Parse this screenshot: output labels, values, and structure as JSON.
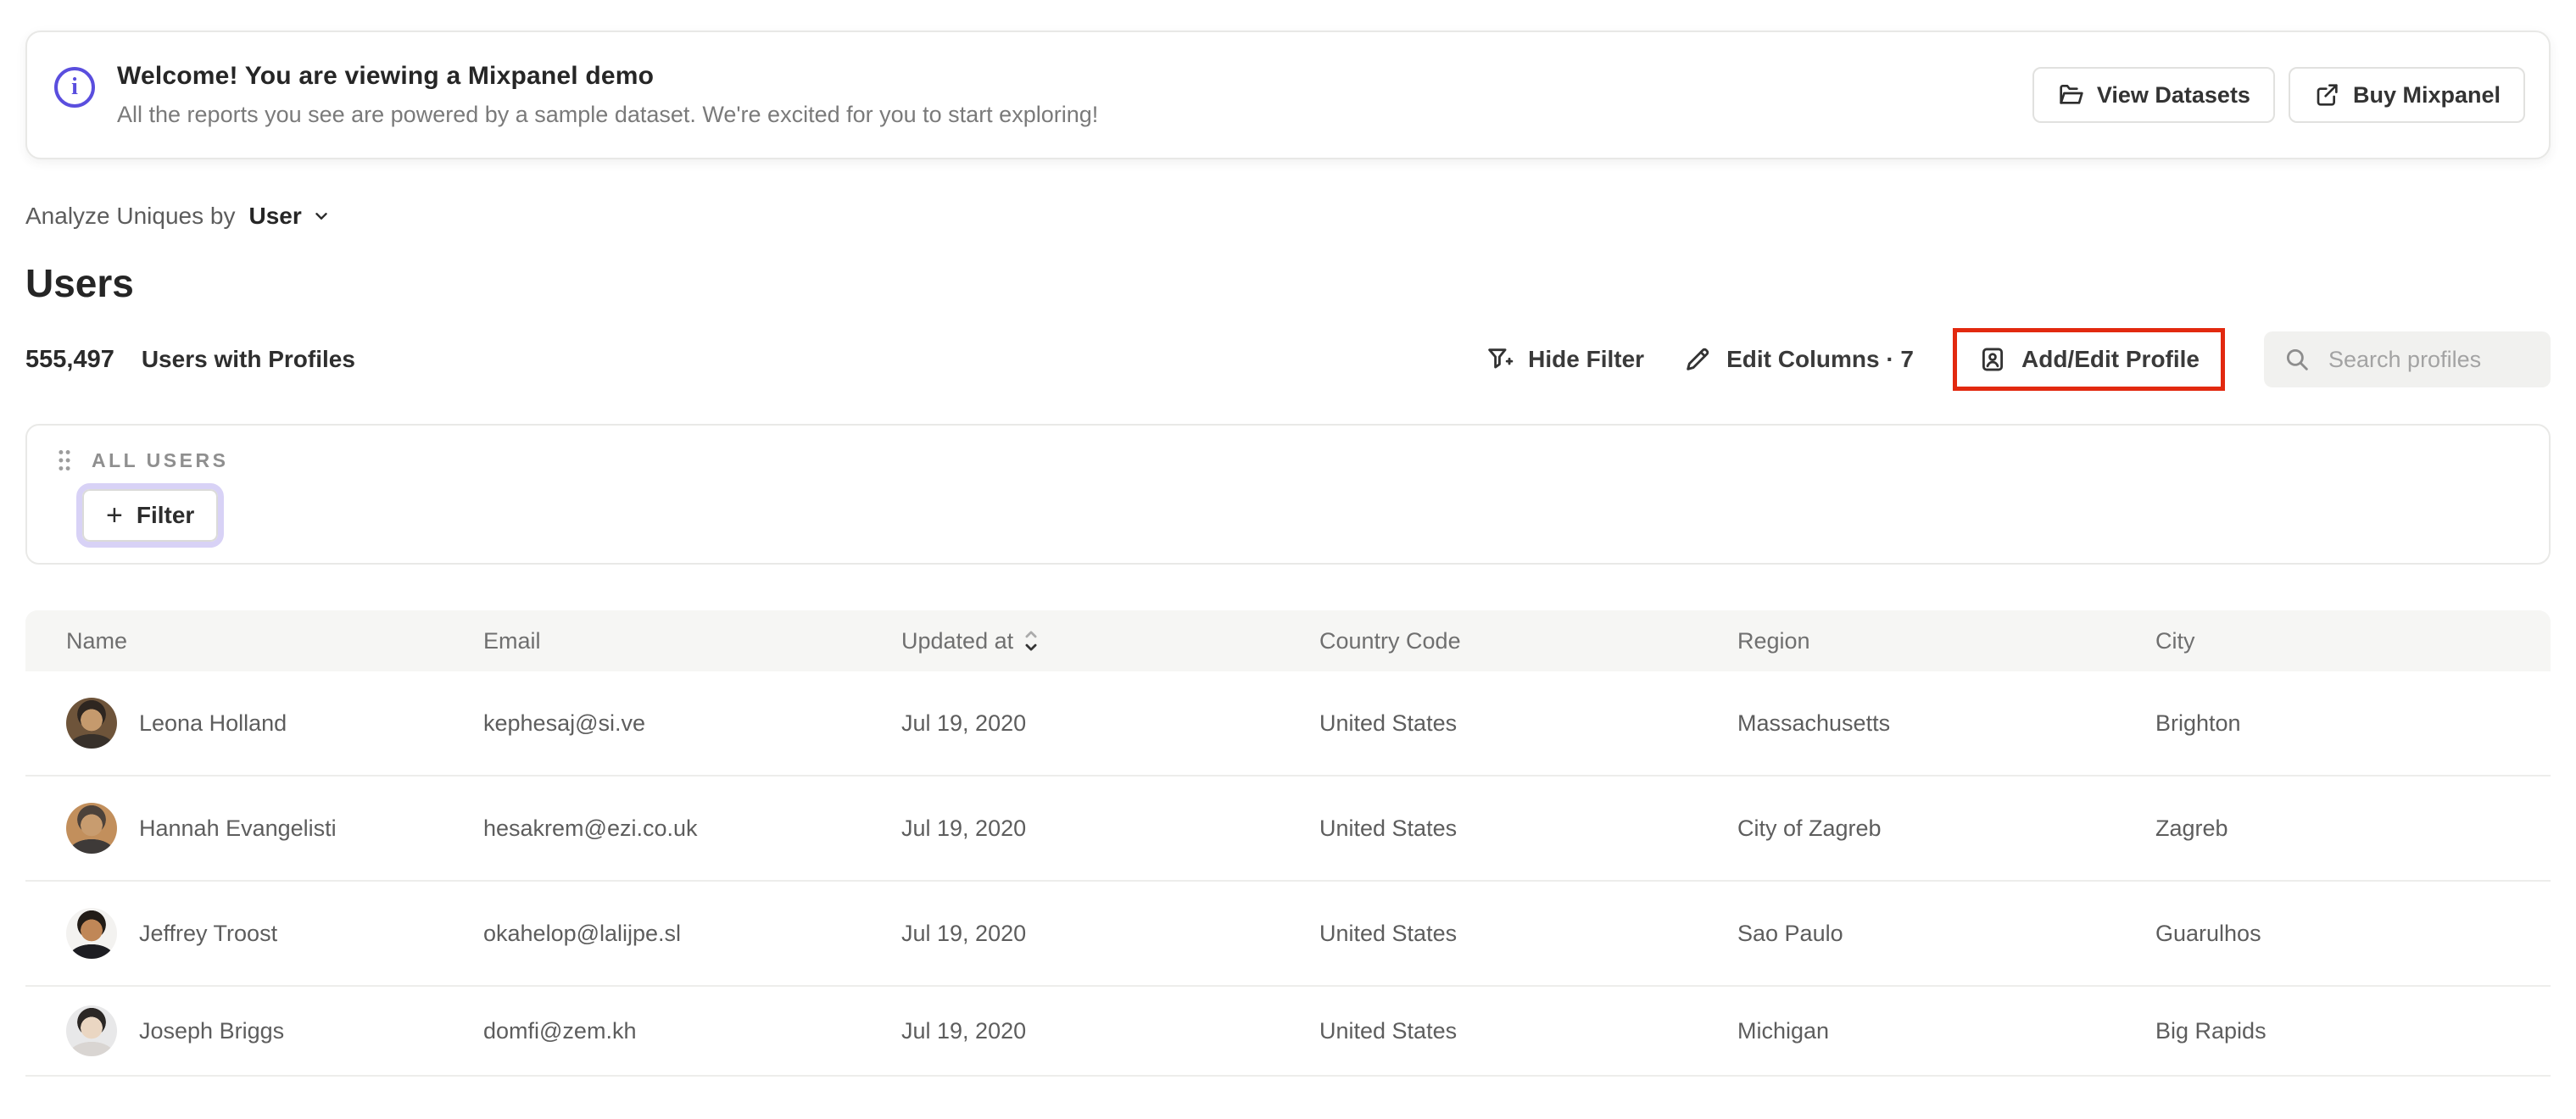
{
  "banner": {
    "title": "Welcome! You are viewing a Mixpanel demo",
    "subtitle": "All the reports you see are powered by a sample dataset. We're excited for you to start exploring!",
    "view_datasets_label": "View Datasets",
    "buy_mixpanel_label": "Buy Mixpanel",
    "info_icon": "info-icon",
    "accent_color": "#5a4ede"
  },
  "controls": {
    "analyze_label": "Analyze Uniques by",
    "analyze_value": "User"
  },
  "page": {
    "title": "Users",
    "count": "555,497",
    "count_label": "Users with Profiles"
  },
  "toolbar": {
    "hide_filter_label": "Hide Filter",
    "edit_columns_label": "Edit Columns · 7",
    "add_edit_profile_label": "Add/Edit Profile",
    "search_placeholder": "Search profiles",
    "highlight_color": "#e2290f"
  },
  "filter_panel": {
    "group_label": "ALL USERS",
    "plus": "+",
    "filter_label": "Filter",
    "focus_ring_color": "#d8d2f6"
  },
  "table": {
    "columns": [
      "Name",
      "Email",
      "Updated at",
      "Country Code",
      "Region",
      "City"
    ],
    "sorted_column": "Updated at",
    "sort_direction": "descending",
    "rows": [
      {
        "name": "Leona Holland",
        "email": "kephesaj@si.ve",
        "updated_at": "Jul 19, 2020",
        "country_code": "United States",
        "region": "Massachusetts",
        "city": "Brighton",
        "avatar": {
          "bg": "#6e543a",
          "hair": "#2e2620",
          "skin": "#c59a6d",
          "shirt": "#37302a"
        }
      },
      {
        "name": "Hannah Evangelisti",
        "email": "hesakrem@ezi.co.uk",
        "updated_at": "Jul 19, 2020",
        "country_code": "United States",
        "region": "City of Zagreb",
        "city": "Zagreb",
        "avatar": {
          "bg": "#c28f5c",
          "hair": "#4d423a",
          "skin": "#c89c6f",
          "shirt": "#3e3a38"
        }
      },
      {
        "name": "Jeffrey Troost",
        "email": "okahelop@lalijpe.sl",
        "updated_at": "Jul 19, 2020",
        "country_code": "United States",
        "region": "Sao Paulo",
        "city": "Guarulhos",
        "avatar": {
          "bg": "#f3f2f0",
          "hair": "#221c17",
          "skin": "#c08757",
          "shirt": "#1d1d22"
        }
      },
      {
        "name": "Joseph Briggs",
        "email": "domfi@zem.kh",
        "updated_at": "Jul 19, 2020",
        "country_code": "United States",
        "region": "Michigan",
        "city": "Big Rapids",
        "avatar": {
          "bg": "#e8e8e9",
          "hair": "#2b2725",
          "skin": "#ead6c2",
          "shirt": "#d9d5d2"
        }
      }
    ]
  }
}
